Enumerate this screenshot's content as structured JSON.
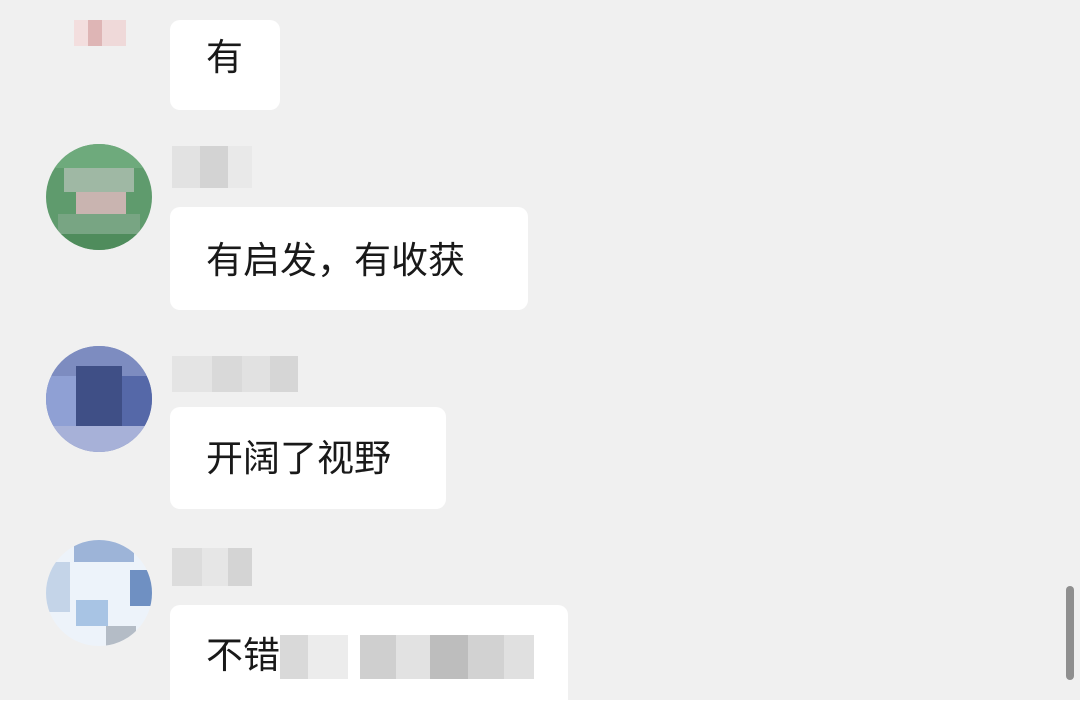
{
  "messages": [
    {
      "text": "有"
    },
    {
      "text": "有启发，有收获"
    },
    {
      "text": "开阔了视野"
    },
    {
      "text": "不错"
    }
  ],
  "colors": {
    "chat_background": "#f0f0f0",
    "bubble_background": "#ffffff",
    "message_text": "#191919",
    "scrollbar": "#8f8f8f"
  },
  "icons": {
    "avatar_1": "pixelated-avatar",
    "avatar_2": "pixelated-avatar",
    "avatar_3": "pixelated-avatar",
    "avatar_4": "pixelated-avatar"
  }
}
